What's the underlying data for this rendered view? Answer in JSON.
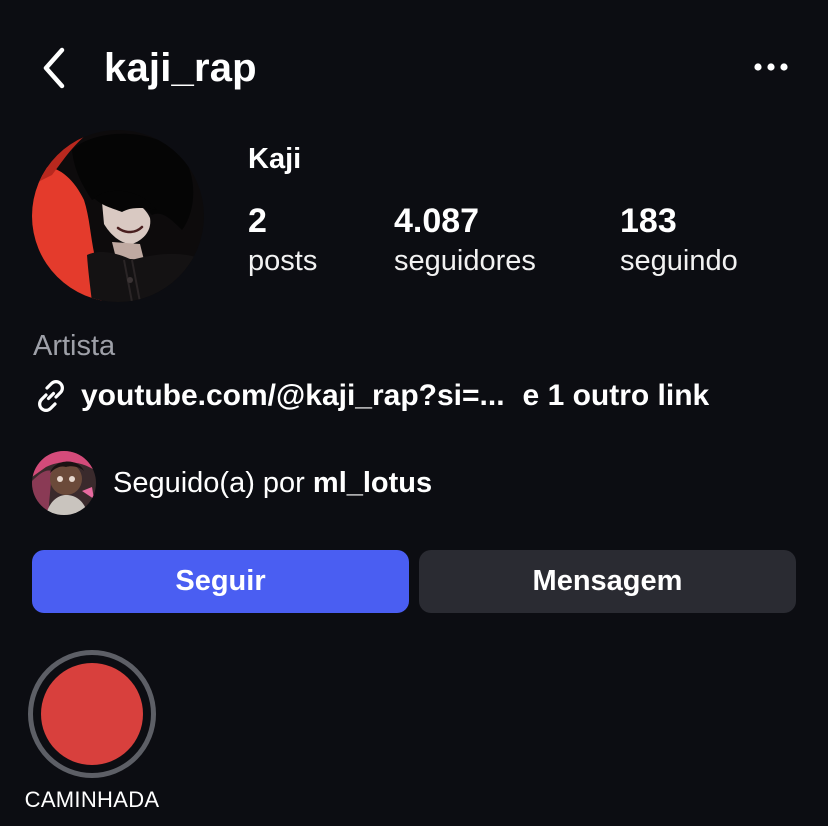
{
  "header": {
    "username": "kaji_rap",
    "back_icon": "chevron-left-icon",
    "more_icon": "more-horizontal-icon"
  },
  "profile": {
    "display_name": "Kaji",
    "avatar_description_icon": "profile-avatar",
    "avatar_colors": {
      "background": "#e43b2c",
      "figure": "#0a0a0a"
    }
  },
  "stats": {
    "posts": {
      "count": "2",
      "label": "posts"
    },
    "followers": {
      "count": "4.087",
      "label": "seguidores"
    },
    "following": {
      "count": "183",
      "label": "seguindo"
    }
  },
  "bio": {
    "category": "Artista",
    "link_icon": "link-icon",
    "link_text": "youtube.com/@kaji_rap?si=...",
    "other_links": "e 1 outro link"
  },
  "followed_by": {
    "prefix": "Seguido(a) por ",
    "username": "ml_lotus"
  },
  "actions": {
    "follow_label": "Seguir",
    "message_label": "Mensagem"
  },
  "highlights": [
    {
      "label": "CAMINHADA",
      "color": "#d8403d"
    }
  ],
  "colors": {
    "background": "#0c0d12",
    "accent": "#4a5ef2",
    "secondary_button": "#2a2b32",
    "muted_text": "#9ea0a8"
  }
}
